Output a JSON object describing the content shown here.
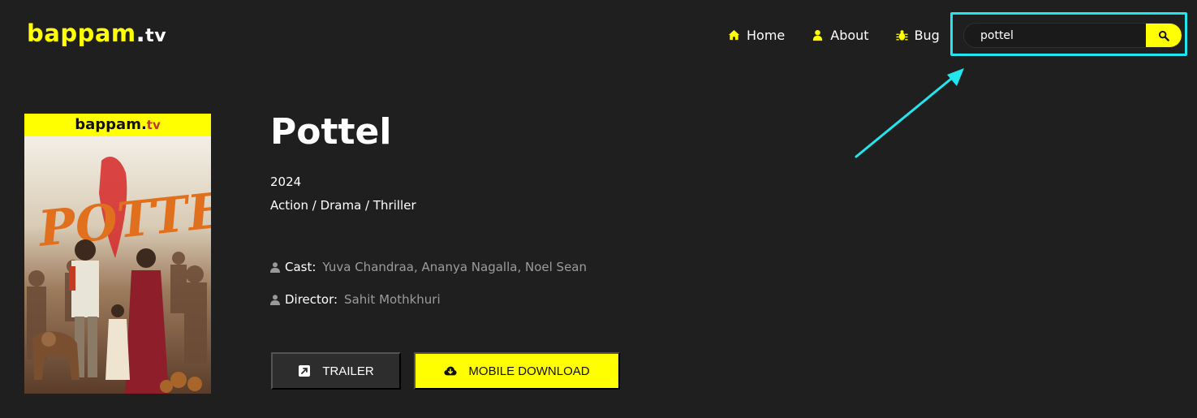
{
  "header": {
    "logo_main": "bappam",
    "logo_dot": ".",
    "logo_tv": "tv",
    "nav": [
      {
        "label": "Home",
        "icon": "home-icon"
      },
      {
        "label": "About",
        "icon": "user-icon"
      },
      {
        "label": "Bug",
        "icon": "bug-icon"
      }
    ],
    "search": {
      "value": "pottel",
      "icon": "search-icon"
    }
  },
  "poster": {
    "band_main": "bappam",
    "band_dot": ".",
    "band_tv": "tv"
  },
  "movie": {
    "title": "Pottel",
    "year": "2024",
    "genres": "Action / Drama / Thriller",
    "cast_label": "Cast:",
    "cast_value": "Yuva Chandraa, Ananya Nagalla, Noel Sean",
    "director_label": "Director:",
    "director_value": "Sahit Mothkhuri"
  },
  "actions": {
    "trailer_label": "TRAILER",
    "download_label": "MOBILE DOWNLOAD"
  },
  "colors": {
    "accent": "#ffff00",
    "background": "#1f1f1f",
    "highlight": "#22e5ee"
  }
}
